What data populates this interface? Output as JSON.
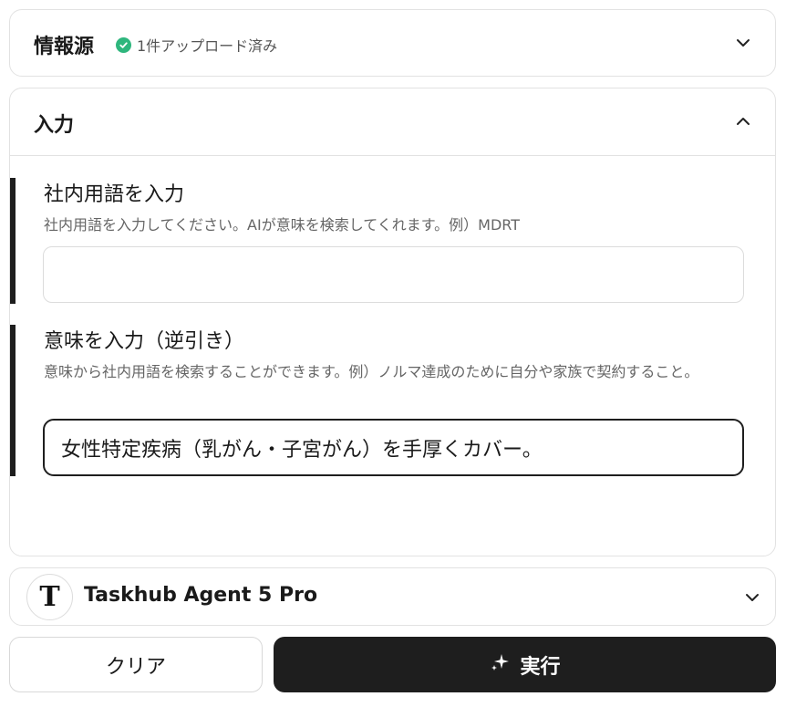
{
  "sources": {
    "title": "情報源",
    "status": "1件アップロード済み"
  },
  "input_section": {
    "title": "入力",
    "term_field": {
      "label": "社内用語を入力",
      "description": "社内用語を入力してください。AIが意味を検索してくれます。例）MDRT",
      "value": ""
    },
    "meaning_field": {
      "label": "意味を入力（逆引き）",
      "description": "意味から社内用語を検索することができます。例）ノルマ達成のために自分や家族で契約すること。",
      "value": "女性特定疾病（乳がん・子宮がん）を手厚くカバー。"
    }
  },
  "model": {
    "avatar_letter": "T",
    "name": "Taskhub Agent 5 Pro"
  },
  "actions": {
    "clear_label": "クリア",
    "run_label": "実行"
  },
  "colors": {
    "accent": "#1e1e1e",
    "success": "#2eb67d",
    "border": "#e2e2e2"
  }
}
